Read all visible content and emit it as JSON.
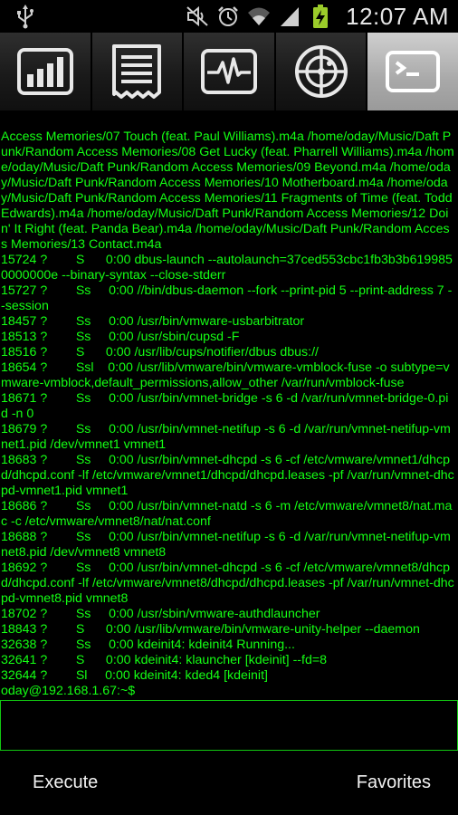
{
  "status_bar": {
    "icons": [
      "usb-icon",
      "mute-icon",
      "alarm-icon",
      "wifi-icon",
      "signal-icon",
      "battery-charging-icon"
    ],
    "time": "12:07 AM"
  },
  "tabs": [
    {
      "icon": "bar-chart-icon",
      "active": false
    },
    {
      "icon": "receipt-list-icon",
      "active": false
    },
    {
      "icon": "heartbeat-monitor-icon",
      "active": false
    },
    {
      "icon": "radar-icon",
      "active": false
    },
    {
      "icon": "terminal-icon",
      "active": true
    }
  ],
  "terminal": {
    "lines": [
      "Access Memories/07 Touch (feat. Paul Williams).m4a /home/oday/Music/Daft Punk/Random Access Memories/08 Get Lucky (feat. Pharrell Williams).m4a /home/oday/Music/Daft Punk/Random Access Memories/09 Beyond.m4a /home/oday/Music/Daft Punk/Random Access Memories/10 Motherboard.m4a /home/oday/Music/Daft Punk/Random Access Memories/11 Fragments of Time (feat. Todd Edwards).m4a /home/oday/Music/Daft Punk/Random Access Memories/12 Doin' It Right (feat. Panda Bear).m4a /home/oday/Music/Daft Punk/Random Access Memories/13 Contact.m4a",
      "15724 ?        S      0:00 dbus-launch --autolaunch=37ced553cbc1fb3b3b6199850000000e --binary-syntax --close-stderr",
      "15727 ?        Ss     0:00 //bin/dbus-daemon --fork --print-pid 5 --print-address 7 --session",
      "18457 ?        Ss     0:00 /usr/bin/vmware-usbarbitrator",
      "18513 ?        Ss     0:00 /usr/sbin/cupsd -F",
      "18516 ?        S      0:00 /usr/lib/cups/notifier/dbus dbus://",
      "18654 ?        Ssl    0:00 /usr/lib/vmware/bin/vmware-vmblock-fuse -o subtype=vmware-vmblock,default_permissions,allow_other /var/run/vmblock-fuse",
      "18671 ?        Ss     0:00 /usr/bin/vmnet-bridge -s 6 -d /var/run/vmnet-bridge-0.pid -n 0",
      "18679 ?        Ss     0:00 /usr/bin/vmnet-netifup -s 6 -d /var/run/vmnet-netifup-vmnet1.pid /dev/vmnet1 vmnet1",
      "18683 ?        Ss     0:00 /usr/bin/vmnet-dhcpd -s 6 -cf /etc/vmware/vmnet1/dhcpd/dhcpd.conf -lf /etc/vmware/vmnet1/dhcpd/dhcpd.leases -pf /var/run/vmnet-dhcpd-vmnet1.pid vmnet1",
      "18686 ?        Ss     0:00 /usr/bin/vmnet-natd -s 6 -m /etc/vmware/vmnet8/nat.mac -c /etc/vmware/vmnet8/nat/nat.conf",
      "18688 ?        Ss     0:00 /usr/bin/vmnet-netifup -s 6 -d /var/run/vmnet-netifup-vmnet8.pid /dev/vmnet8 vmnet8",
      "18692 ?        Ss     0:00 /usr/bin/vmnet-dhcpd -s 6 -cf /etc/vmware/vmnet8/dhcpd/dhcpd.conf -lf /etc/vmware/vmnet8/dhcpd/dhcpd.leases -pf /var/run/vmnet-dhcpd-vmnet8.pid vmnet8",
      "18702 ?        Ss     0:00 /usr/sbin/vmware-authdlauncher",
      "18843 ?        S      0:00 /usr/lib/vmware/bin/vmware-unity-helper --daemon",
      "32638 ?        Ss     0:00 kdeinit4: kdeinit4 Running...",
      "32641 ?        S      0:00 kdeinit4: klauncher [kdeinit] --fd=8",
      "32644 ?        Sl     0:00 kdeinit4: kded4 [kdeinit]",
      "oday@192.168.1.67:~$"
    ]
  },
  "command_input": {
    "value": ""
  },
  "bottom_bar": {
    "execute_label": "Execute",
    "favorites_label": "Favorites"
  }
}
